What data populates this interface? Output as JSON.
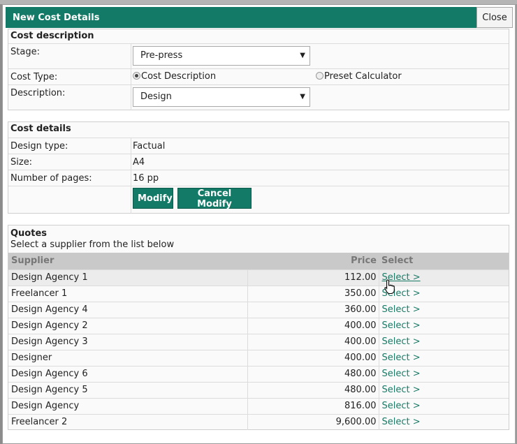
{
  "dialog": {
    "title": "New Cost Details",
    "close_label": "Close"
  },
  "cost_description": {
    "heading": "Cost description",
    "stage_label": "Stage:",
    "stage_value": "Pre-press",
    "cost_type_label": "Cost Type:",
    "cost_type_options": [
      "Cost Description",
      "Preset Calculator"
    ],
    "cost_type_selected": "Cost Description",
    "description_label": "Description:",
    "description_value": "Design"
  },
  "cost_details": {
    "heading": "Cost details",
    "design_type_label": "Design type:",
    "design_type_value": "Factual",
    "size_label": "Size:",
    "size_value": "A4",
    "pages_label": "Number of pages:",
    "pages_value": "16 pp",
    "modify_label": "Modify",
    "cancel_modify_label": "Cancel Modify"
  },
  "quotes": {
    "heading": "Quotes",
    "subtitle": "Select a supplier from the list below",
    "columns": [
      "Supplier",
      "Price",
      "Select"
    ],
    "rows": [
      {
        "supplier": "Design Agency 1",
        "price": "112.00",
        "select": "Select >"
      },
      {
        "supplier": "Freelancer 1",
        "price": "350.00",
        "select": "Select >"
      },
      {
        "supplier": "Design Agency 4",
        "price": "360.00",
        "select": "Select >"
      },
      {
        "supplier": "Design Agency 2",
        "price": "400.00",
        "select": "Select >"
      },
      {
        "supplier": "Design Agency 3",
        "price": "400.00",
        "select": "Select >"
      },
      {
        "supplier": "Designer",
        "price": "400.00",
        "select": "Select >"
      },
      {
        "supplier": "Design Agency 6",
        "price": "480.00",
        "select": "Select >"
      },
      {
        "supplier": "Design Agency 5",
        "price": "480.00",
        "select": "Select >"
      },
      {
        "supplier": "Design Agency",
        "price": "816.00",
        "select": "Select >"
      },
      {
        "supplier": "Freelancer 2",
        "price": "9,600.00",
        "select": "Select >"
      }
    ]
  },
  "colors": {
    "accent": "#127a66",
    "link": "#1a7a66",
    "header_bg": "#c9c9c9"
  }
}
